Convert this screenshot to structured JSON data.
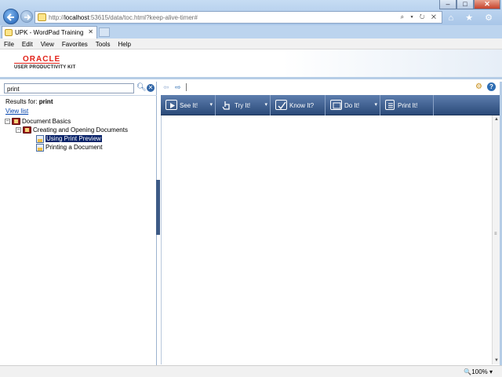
{
  "browser": {
    "address": {
      "url_prefix": "http://",
      "url_host": "localhost",
      "url_rest": ":53615/data/toc.html?keep-alive-timer#",
      "tools": "⌕ ▾ ↻ ✕"
    },
    "window_buttons": {
      "minimize": "–",
      "maximize": "□",
      "close": "✕"
    },
    "right_icons": "⌂ ★ ⚙",
    "tab": {
      "title": "UPK - WordPad Training",
      "close": "✕"
    },
    "menu": [
      "File",
      "Edit",
      "View",
      "Favorites",
      "Tools",
      "Help"
    ],
    "zoom": "🔍100%  ▾"
  },
  "header": {
    "oracle": "ORACLE",
    "subtitle": "USER PRODUCTIVITY KIT"
  },
  "sidebar": {
    "search_value": "print",
    "results_label": "Results for:",
    "results_term": "print",
    "view_list": "View list",
    "tree": [
      {
        "label": "Document Basics",
        "expander": "−"
      },
      {
        "label": "Creating and Opening Documents",
        "expander": "−"
      },
      {
        "label": "Using Print Preview"
      },
      {
        "label": "Printing a Document"
      }
    ]
  },
  "toolbar": {
    "back": "⇦",
    "forward": "⇨",
    "modes": [
      {
        "label": "See It!",
        "dropdown": "▾"
      },
      {
        "label": "Try It!",
        "dropdown": "▾"
      },
      {
        "label": "Know It?"
      },
      {
        "label": "Do It!",
        "dropdown": "▾"
      },
      {
        "label": "Print It!"
      }
    ]
  },
  "icons": {
    "back": "back-icon",
    "forward": "forward-icon",
    "search": "search-icon",
    "clear": "clear-icon",
    "tools": "tools-icon",
    "help": "help-icon"
  },
  "colors": {
    "mode_bar": "#2b4a79",
    "selection": "#0a246a",
    "oracle_red": "#e2231a",
    "link": "#0645ad"
  }
}
